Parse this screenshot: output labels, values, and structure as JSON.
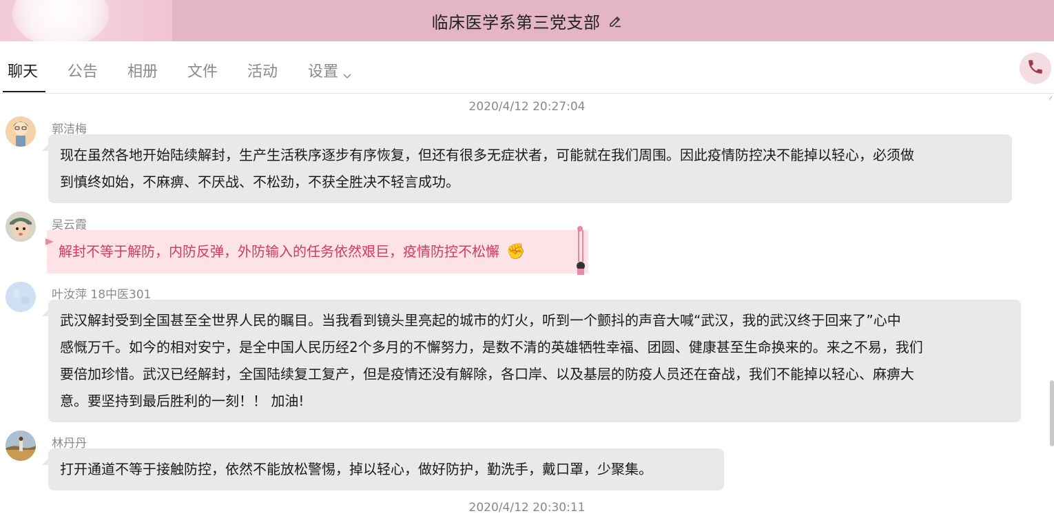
{
  "header": {
    "group_name": "临床医学系第三党支部",
    "edit_icon": "pencil-icon",
    "bar_color": "#e4b6c4"
  },
  "tabs": [
    {
      "label": "聊天",
      "active": true
    },
    {
      "label": "公告",
      "active": false
    },
    {
      "label": "相册",
      "active": false
    },
    {
      "label": "文件",
      "active": false
    },
    {
      "label": "活动",
      "active": false
    },
    {
      "label": "设置",
      "active": false,
      "has_dropdown": true
    }
  ],
  "call_button": {
    "icon": "phone-icon",
    "color": "#9b3b4f"
  },
  "chat": {
    "timestamps": [
      "2020/4/12 20:27:04",
      "2020/4/12 20:30:11"
    ],
    "messages": [
      {
        "sender": "郭洁梅",
        "avatar": "cartoon-girl-avatar",
        "lines": [
          "现在虽然各地开始陆续解封，生产生活秩序逐步有序恢复，但还有很多无症状者，可能就在我们周围。因此疫情防控决不能掉以轻心，必须做",
          "到慎终如始，不麻痹、不厌战、不松劲，不获全胜决不轻言成功。"
        ]
      },
      {
        "sender": "吴云霞",
        "avatar": "baby-photo-avatar",
        "lines": [
          "解封不等于解防，内防反弹，外防输入的任务依然艰巨，疫情防控不松懈"
        ],
        "emoji": "✊",
        "bubble_style": "pink-theme",
        "text_color": "#d23a62"
      },
      {
        "sender": "叶汝萍 18中医301",
        "avatar": "light-blue-avatar",
        "lines": [
          "武汉解封受到全国甚至全世界人民的瞩目。当我看到镜头里亮起的城市的灯火，听到一个颤抖的声音大喊“武汉，我的武汉终于回来了”心中",
          "感慨万千。如今的相对安宁，是全中国人民历经2个多月的不懈努力，是数不清的英雄牺牲幸福、团圆、健康甚至生命换来的。来之不易，我们",
          "要倍加珍惜。武汉已经解封，全国陆续复工复产，但是疫情还没有解除，各口岸、以及基层的防疫人员还在奋战，我们不能掉以轻心、麻痹大",
          "意。要坚持到最后胜利的一刻！！ 加油!"
        ]
      },
      {
        "sender": "林丹丹",
        "avatar": "landscape-photo-avatar",
        "lines": [
          "打开通道不等于接触防控，依然不能放松警惕，掉以轻心，做好防护，勤洗手，戴口罩，少聚集。"
        ]
      }
    ]
  }
}
